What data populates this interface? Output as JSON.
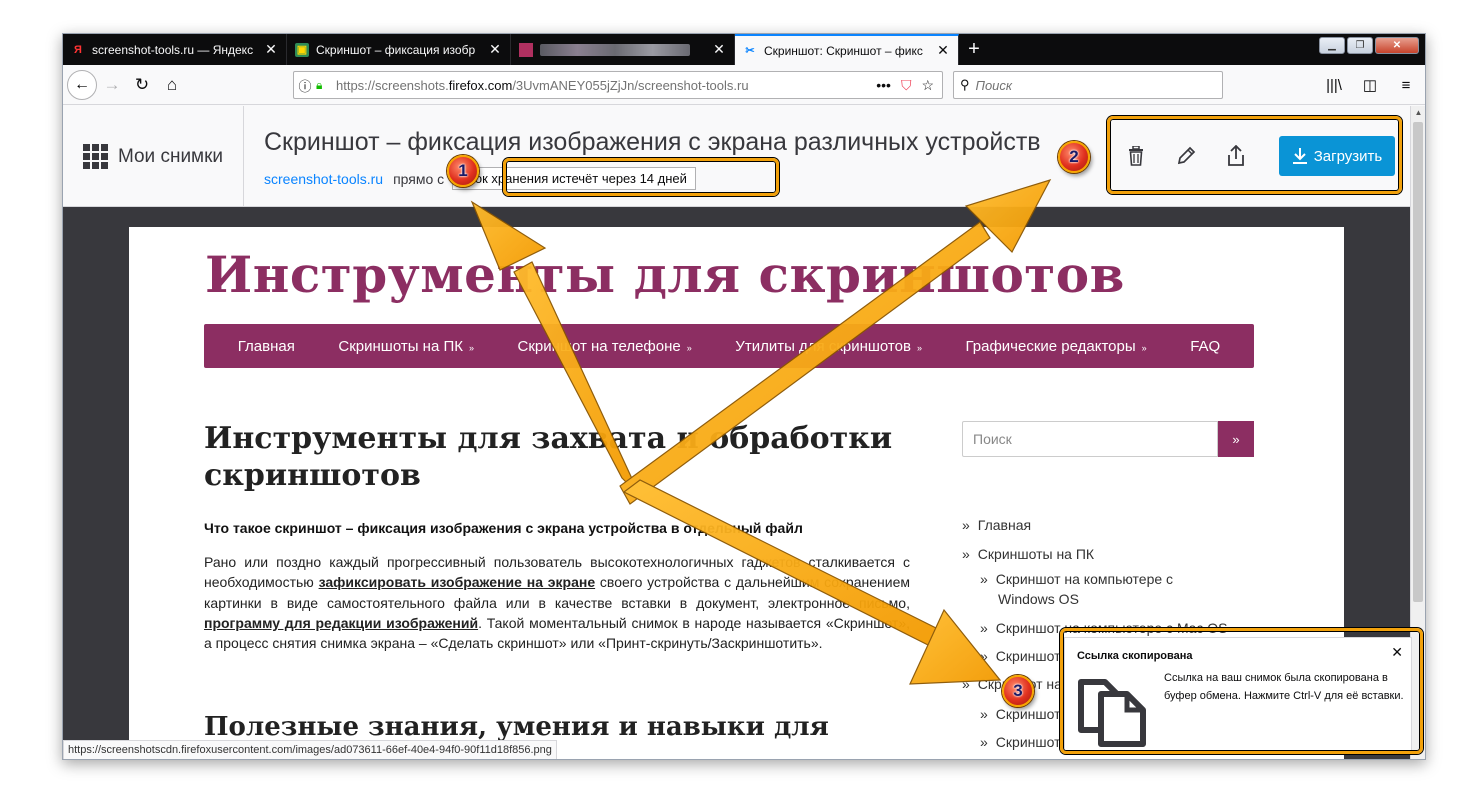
{
  "tabs": [
    {
      "favicon": "yandex-icon",
      "favicon_char": "Я",
      "title": "screenshot-tools.ru — Яндекс",
      "active": false
    },
    {
      "favicon": "screenshot-site-icon",
      "favicon_char": "▣",
      "title": "Скриншот – фиксация изобр",
      "active": false
    },
    {
      "favicon": "blurred-icon",
      "favicon_char": "",
      "title": "",
      "active": false
    },
    {
      "favicon": "firefox-screenshots-icon",
      "favicon_char": "✂",
      "title": "Скриншот: Скриншот – фикс",
      "active": true
    }
  ],
  "nav": {
    "url_prefix": "https://screenshots.",
    "url_domain": "firefox.com",
    "url_suffix": "/3UvmANEY055jZjJn/screenshot-tools.ru",
    "search_placeholder": "Поиск"
  },
  "shot_header": {
    "my_shots_label": "Мои снимки",
    "title": "Скриншот – фиксация изображения с экрана различных устройств",
    "source_link": "screenshot-tools.ru",
    "source_text": "прямо с",
    "expire_text": "срок хранения истечёт через 14 дней",
    "download_label": "Загрузить"
  },
  "site": {
    "title": "Инструменты для скриншотов",
    "nav": [
      {
        "label": "Главная",
        "has_sub": false
      },
      {
        "label": "Скриншоты на ПК",
        "has_sub": true
      },
      {
        "label": "Скриншот на телефоне",
        "has_sub": true
      },
      {
        "label": "Утилиты для скриншотов",
        "has_sub": true
      },
      {
        "label": "Графические редакторы",
        "has_sub": true
      },
      {
        "label": "FAQ",
        "has_sub": false
      }
    ],
    "nav_chevron": "»",
    "heading": "Инструменты для захвата и обработки скриншотов",
    "subheading": "Что такое скриншот – фиксация изображения с экрана устройства в отдельный файл",
    "para_1": "Рано или поздно каждый прогрессивный пользователь высокотехнологичных гадже­тов сталкивается с необходимостью ",
    "para_link_1": "зафиксировать изображение на экране",
    "para_2": " своего устройства с дальнейшим сохранением картинки в виде самостоятельного файла или в качестве вставки в документ, электронное письмо, ",
    "para_link_2": "программу для редакции изображений",
    "para_3": ". Такой моментальный снимок в народе называется «Скриншот», а процесс снятия снимка экрана – «Сделать скриншот» или «Принт-скринуть/Заскриншотить».",
    "heading_2": "Полезные знания, умения и навыки для работы и",
    "side_search_placeholder": "Поиск",
    "side_search_button": "»",
    "side_menu": [
      {
        "label": "Главная",
        "level": 0
      },
      {
        "label": "Скриншоты на ПК",
        "level": 0
      },
      {
        "label": "Скриншот на компьютере с",
        "level": 1
      },
      {
        "label": "Windows OS",
        "level": 2
      },
      {
        "label": "Скриншот на компьютере с Mac OS",
        "level": 1
      },
      {
        "label": "Скриншот на ноутбуке Windows OS",
        "level": 1
      },
      {
        "label": "Скриншот на телефоне",
        "level": 0
      },
      {
        "label": "Скриншот на Андроиде",
        "level": 1
      },
      {
        "label": "Скриншот на iPhone",
        "level": 1
      }
    ]
  },
  "status_url": "https://screenshotscdn.firefoxusercontent.com/images/ad073611-66ef-40e4-94f0-90f11d18f856.png",
  "notification": {
    "title": "Ссылка скопирована",
    "body": "Ссылка на ваш снимок была скопирована в буфер обмена. Нажмите Ctrl-V для её вставки.",
    "close": "✕"
  },
  "annotations": {
    "badges": [
      "1",
      "2",
      "3"
    ],
    "color": "#f2a10b"
  }
}
